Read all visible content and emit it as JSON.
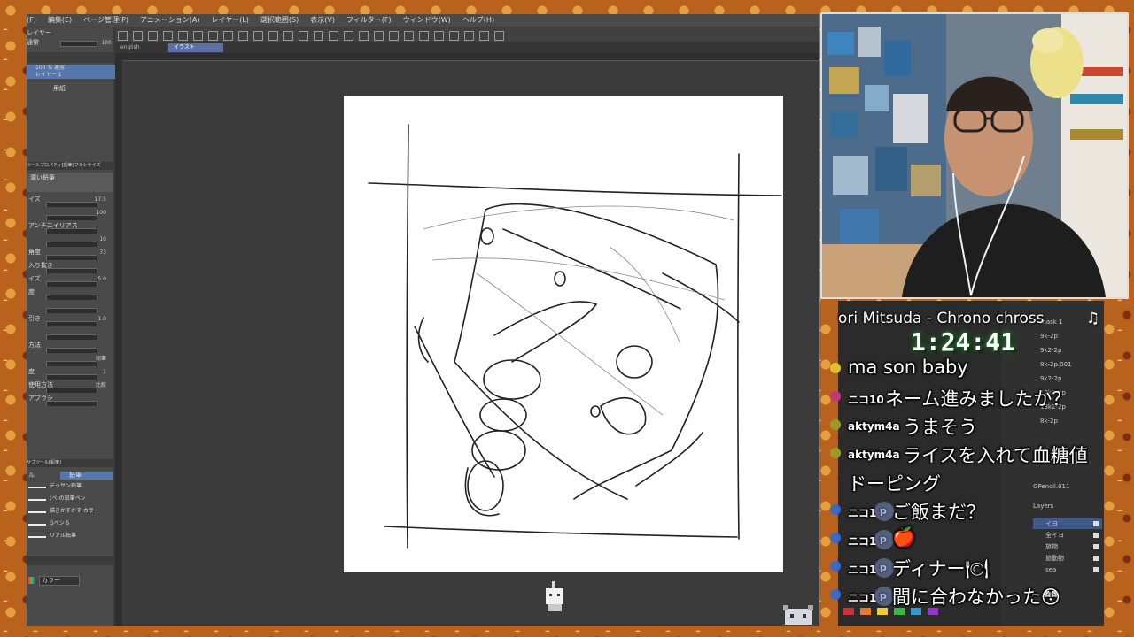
{
  "menu": [
    "(F)",
    "編集(E)",
    "ページ管理(P)",
    "アニメーション(A)",
    "レイヤー(L)",
    "選択範囲(S)",
    "表示(V)",
    "フィルター(F)",
    "ウィンドウ(W)",
    "ヘルプ(H)"
  ],
  "tabs": [
    "english",
    "イラスト"
  ],
  "left_panel": {
    "layer_header": "レイヤー",
    "blend_mode": "通常",
    "opacity_value": "100",
    "layer_name_line1": "100 % 通常",
    "layer_name_line2": "レイヤー 1",
    "paper_layer": "用紙",
    "tool_property_title": "ツールプロパティ[鉛筆]ブラシサイズ",
    "brush_name": "濃い鉛筆",
    "props": [
      {
        "label": "イズ",
        "value": "17.5"
      },
      {
        "label": "",
        "value": "100"
      },
      {
        "label": "アンチエイリアス",
        "value": ""
      },
      {
        "label": "",
        "value": "10"
      },
      {
        "label": "角度",
        "value": "73"
      },
      {
        "label": "入り抜き",
        "value": ""
      },
      {
        "label": "イズ",
        "value": "5.0"
      },
      {
        "label": "度",
        "value": ""
      },
      {
        "label": "",
        "value": ""
      },
      {
        "label": "引き",
        "value": "1.0"
      },
      {
        "label": "",
        "value": ""
      },
      {
        "label": "方法",
        "value": ""
      },
      {
        "label": "",
        "value": "鉛筆"
      },
      {
        "label": "度",
        "value": "1"
      },
      {
        "label": "使用方法",
        "value": "比較"
      },
      {
        "label": "アブラシ",
        "value": ""
      }
    ],
    "subtool_title": "サブツール[鉛筆]",
    "subtool_tabs": [
      "ル",
      "鉛筆"
    ],
    "subtools": [
      "デッサン鉛筆",
      "(ペ)の鉛筆ペン",
      "描きかすかす カラー",
      "Gペン 5",
      "リアル鉛筆"
    ],
    "color_label": "カラー"
  },
  "stream": {
    "song": "ori Mitsuda - Chrono chross",
    "note_icon": "♫",
    "timer": "1:24:41"
  },
  "chat": [
    {
      "user": "",
      "text": "ma son baby",
      "icon_color": "#e0c030",
      "p": false
    },
    {
      "user": "ニコ10",
      "text": "ネーム進みましたか？",
      "icon_color": "#c03a7a",
      "p": false
    },
    {
      "user": "aktym4a",
      "text": "うまそう",
      "icon_color": "#9a9a2a",
      "p": false
    },
    {
      "user": "aktym4a",
      "text": "ライスを入れて血糖値",
      "icon_color": "#9a9a2a",
      "p": false
    },
    {
      "user": "",
      "text": "ドーピング",
      "icon_color": "",
      "p": false
    },
    {
      "user": "ニコ1",
      "text": "ご飯まだ？",
      "icon_color": "#3a6ac8",
      "p": true
    },
    {
      "user": "ニコ1",
      "text": "🍎",
      "icon_color": "#3a6ac8",
      "p": true
    },
    {
      "user": "ニコ1",
      "text": "ディナー🍽",
      "icon_color": "#3a6ac8",
      "p": true
    },
    {
      "user": "ニコ1",
      "text": "間に合わなかった😳",
      "icon_color": "#3a6ac8",
      "p": true
    }
  ],
  "blender": {
    "object_name": "GPencil.011",
    "layers_title": "Layers",
    "layers": [
      "イヨ",
      "全イヨ",
      "旅物",
      "旅動物",
      "sea"
    ],
    "sidebar_items": [
      "mask 1",
      "9k-2p",
      "9k2-2p",
      "8k-2p.001",
      "9k2-2p",
      "12k2-2p",
      "13k2-2p",
      "8k-2p"
    ]
  },
  "colors": {
    "chat_icon_pink": "#c03a7a",
    "chat_icon_blue": "#3a6ac8",
    "timer_glow": "#1b7a2a"
  }
}
